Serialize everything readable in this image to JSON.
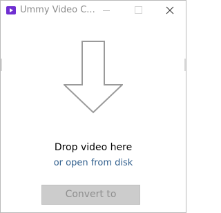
{
  "window": {
    "title": "Ummy Video C...",
    "icons": {
      "app": "video-play-icon",
      "minimize": "minimize-icon",
      "maximize": "maximize-icon",
      "close": "close-icon"
    }
  },
  "drop_area": {
    "arrow_icon": "down-arrow-icon",
    "prompt": "Drop video here",
    "open_link": "or open from disk"
  },
  "footer": {
    "convert_label": "Convert to"
  },
  "colors": {
    "accent": "#6f2fd1",
    "link": "#2e5d8c",
    "disabled_button_bg": "#cccccc",
    "disabled_button_text": "#8e8e8e"
  }
}
